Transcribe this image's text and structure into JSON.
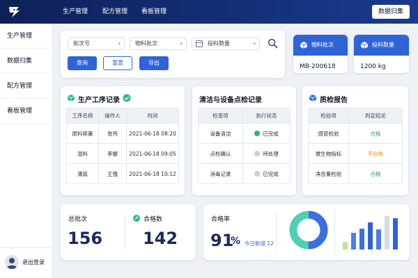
{
  "header": {
    "nav": [
      "生产管理",
      "配方管理",
      "看板管理"
    ],
    "action_button": "数据归集"
  },
  "sidebar": {
    "items": [
      "生产管理",
      "数据归集",
      "配方管理",
      "看板管理"
    ],
    "logout": "退出登录"
  },
  "filters": {
    "batch_no": "批次号",
    "material_batch": "物料批次",
    "feed_qty": "投料数量",
    "query": "查询",
    "reset": "重置",
    "export": "导出"
  },
  "info_cards": [
    {
      "title": "物料批次",
      "value": "MB-200618"
    },
    {
      "title": "投料数量",
      "value": "1200 kg"
    }
  ],
  "production": {
    "title": "生产工序记录",
    "columns": [
      "工序名称",
      "操作人",
      "时间"
    ],
    "rows": [
      [
        "原料称量",
        "张伟",
        "2021-06-18 08:20"
      ],
      [
        "混料",
        "李娜",
        "2021-06-18 09:05"
      ],
      [
        "灌装",
        "王强",
        "2021-06-18 10:12"
      ]
    ]
  },
  "inspection": {
    "title": "清洁与设备点检记录",
    "columns": [
      "检查项",
      "执行状态"
    ],
    "rows": [
      {
        "item": "设备清洁",
        "status": "已完成",
        "state": "done"
      },
      {
        "item": "点检确认",
        "status": "待处理",
        "state": "pending"
      },
      {
        "item": "消毒记录",
        "status": "已完成",
        "state": "done"
      }
    ]
  },
  "quality": {
    "title": "质检报告",
    "columns": [
      "检验项",
      "判定结论"
    ],
    "rows": [
      {
        "item": "感官检验",
        "result": "合格",
        "tone": "green"
      },
      {
        "item": "微生物指标",
        "result": "不合格",
        "tone": "orange"
      },
      {
        "item": "净含量检验",
        "result": "合格",
        "tone": "green"
      }
    ]
  },
  "stats": {
    "total_batches_label": "总批次",
    "total_batches": "156",
    "qualified_label": "合格数",
    "qualified": "142",
    "pass_rate_label": "合格率",
    "pass_rate": "91",
    "pass_rate_unit": "%",
    "today_new": "今日新增 12",
    "donut_fraction": 0.91
  },
  "mini_bars": [
    0.22,
    0.48,
    0.6,
    0.78,
    0.58,
    0.95,
    0.9
  ],
  "colors": {
    "primary": "#2f63d8",
    "header": "#14307a",
    "green": "#22b573",
    "orange": "#f08a24",
    "donut_teal": "#4fd0b0"
  }
}
